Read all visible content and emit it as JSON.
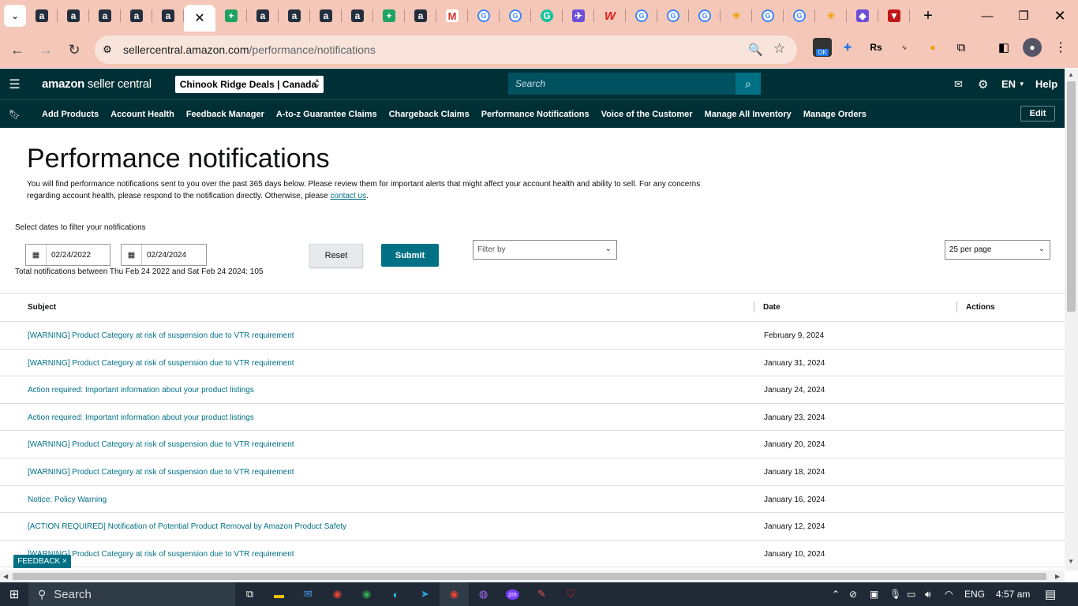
{
  "browser": {
    "url_host": "sellercentral.amazon.com",
    "url_path": "/performance/notifications",
    "ext_badge": "OK",
    "ext_rs": "Rs"
  },
  "header": {
    "brand_bold": "amazon",
    "brand_rest": " seller central",
    "store": "Chinook Ridge Deals | Canada",
    "search_placeholder": "Search",
    "language": "EN",
    "help": "Help"
  },
  "bookmarks": [
    "Add Products",
    "Account Health",
    "Feedback Manager",
    "A-to-z Guarantee Claims",
    "Chargeback Claims",
    "Performance Notifications",
    "Voice of the Customer",
    "Manage All Inventory",
    "Manage Orders"
  ],
  "edit_label": "Edit",
  "page": {
    "title": "Performance notifications",
    "intro": "You will find performance notifications sent to you over the past 365 days below. Please review them for important alerts that might affect your account health and ability to sell. For any concerns regarding account health, please respond to the notification directly. Otherwise, please ",
    "intro_link": "contact us",
    "intro_end": ".",
    "filter_label": "Select dates to filter your notifications",
    "date_from": "02/24/2022",
    "date_to": "02/24/2024",
    "reset": "Reset",
    "submit": "Submit",
    "filter_by": "Filter by",
    "per_page": "25 per page",
    "total": "Total notifications between Thu Feb 24 2022 and Sat Feb 24 2024: 105"
  },
  "table": {
    "headers": {
      "subject": "Subject",
      "date": "Date",
      "actions": "Actions"
    },
    "rows": [
      {
        "subject": "[WARNING] Product Category at risk of suspension due to VTR requirement",
        "date": "February 9, 2024"
      },
      {
        "subject": "[WARNING] Product Category at risk of suspension due to VTR requirement",
        "date": "January 31, 2024"
      },
      {
        "subject": "Action required: Important information about your product listings",
        "date": "January 24, 2024"
      },
      {
        "subject": "Action required: Important information about your product listings",
        "date": "January 23, 2024"
      },
      {
        "subject": "[WARNING] Product Category at risk of suspension due to VTR requirement",
        "date": "January 20, 2024"
      },
      {
        "subject": "[WARNING] Product Category at risk of suspension due to VTR requirement",
        "date": "January 18, 2024"
      },
      {
        "subject": "Notice: Policy Warning",
        "date": "January 16, 2024"
      },
      {
        "subject": "[ACTION REQUIRED] Notification of Potential Product Removal by Amazon Product Safety",
        "date": "January 12, 2024"
      },
      {
        "subject": "[WARNING] Product Category at risk of suspension due to VTR requirement",
        "date": "January 10, 2024"
      }
    ]
  },
  "feedback": "FEEDBACK ×",
  "taskbar": {
    "search": "Search",
    "lang": "ENG",
    "time": "4:57 am"
  },
  "colors": {
    "accent": "#007185",
    "nav_bg": "#002f36",
    "chrome_bg": "#f4c7b8"
  }
}
